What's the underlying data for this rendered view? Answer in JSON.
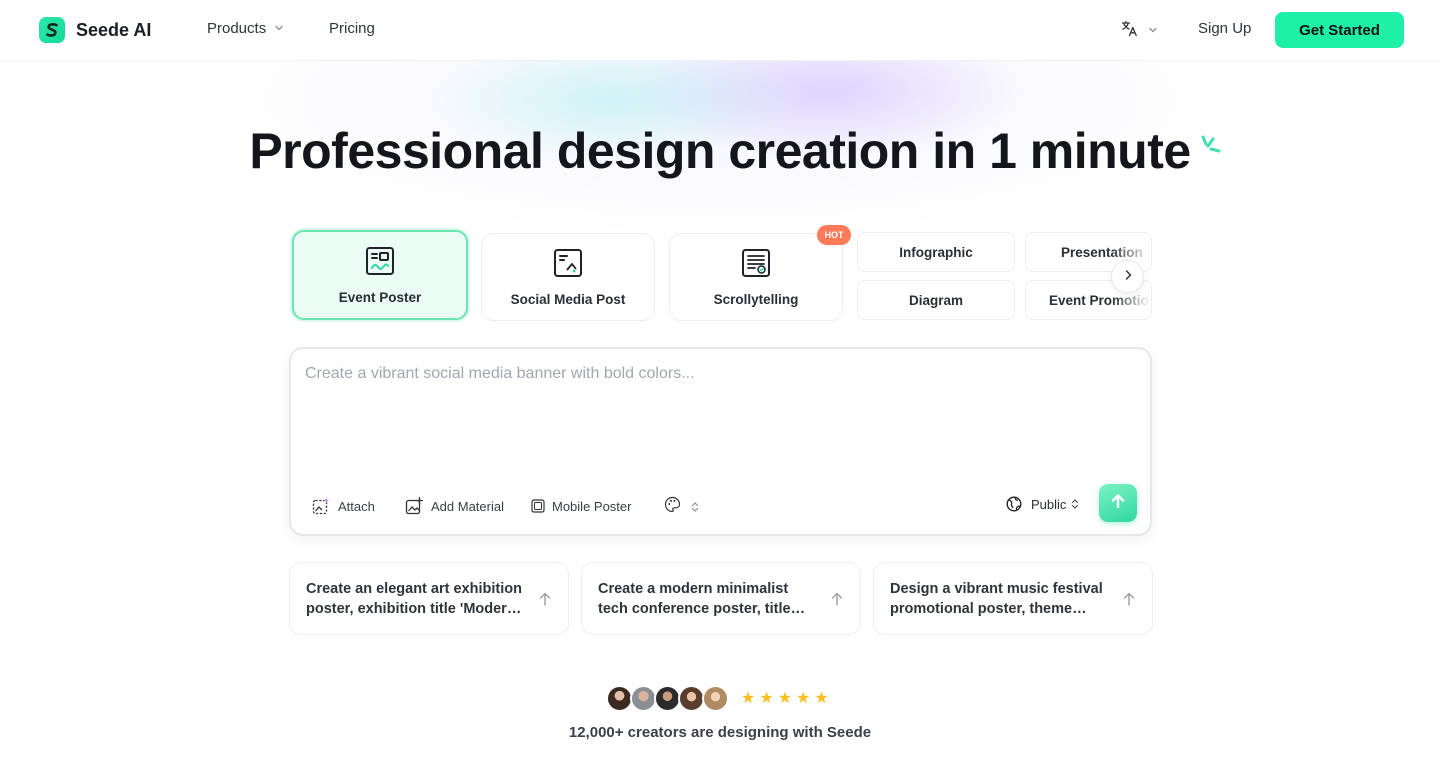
{
  "brand": {
    "name": "Seede AI",
    "accent": "#1ff0a7"
  },
  "nav": {
    "products_label": "Products",
    "pricing_label": "Pricing",
    "language_icon": "translate-icon",
    "signup_label": "Sign Up",
    "get_started_label": "Get Started"
  },
  "hero": {
    "title": "Professional design creation in 1 minute"
  },
  "categories": {
    "cards": [
      {
        "label": "Event Poster",
        "icon": "event-poster-icon",
        "selected": true
      },
      {
        "label": "Social Media Post",
        "icon": "social-media-post-icon",
        "selected": false
      },
      {
        "label": "Scrollytelling",
        "icon": "scrollytelling-icon",
        "selected": false,
        "badge": "HOT"
      }
    ],
    "chips": [
      "Infographic",
      "Presentation",
      "Diagram",
      "Event Promotion"
    ]
  },
  "prompt": {
    "placeholder": "Create a vibrant social media banner with bold colors...",
    "attach_label": "Attach",
    "add_material_label": "Add Material",
    "format_label": "Mobile Poster",
    "visibility_label": "Public"
  },
  "suggestions": [
    "Create an elegant art exhibition poster, exhibition title 'Modern Art Expo'",
    "Create a modern minimalist tech conference poster, title 'Future Tech Summit'",
    "Design a vibrant music festival promotional poster, theme 'Summer Beats'"
  ],
  "social_proof": {
    "text": "12,000+ creators are designing with Seede",
    "rating_stars": 5,
    "star_color": "#fbbf24"
  }
}
